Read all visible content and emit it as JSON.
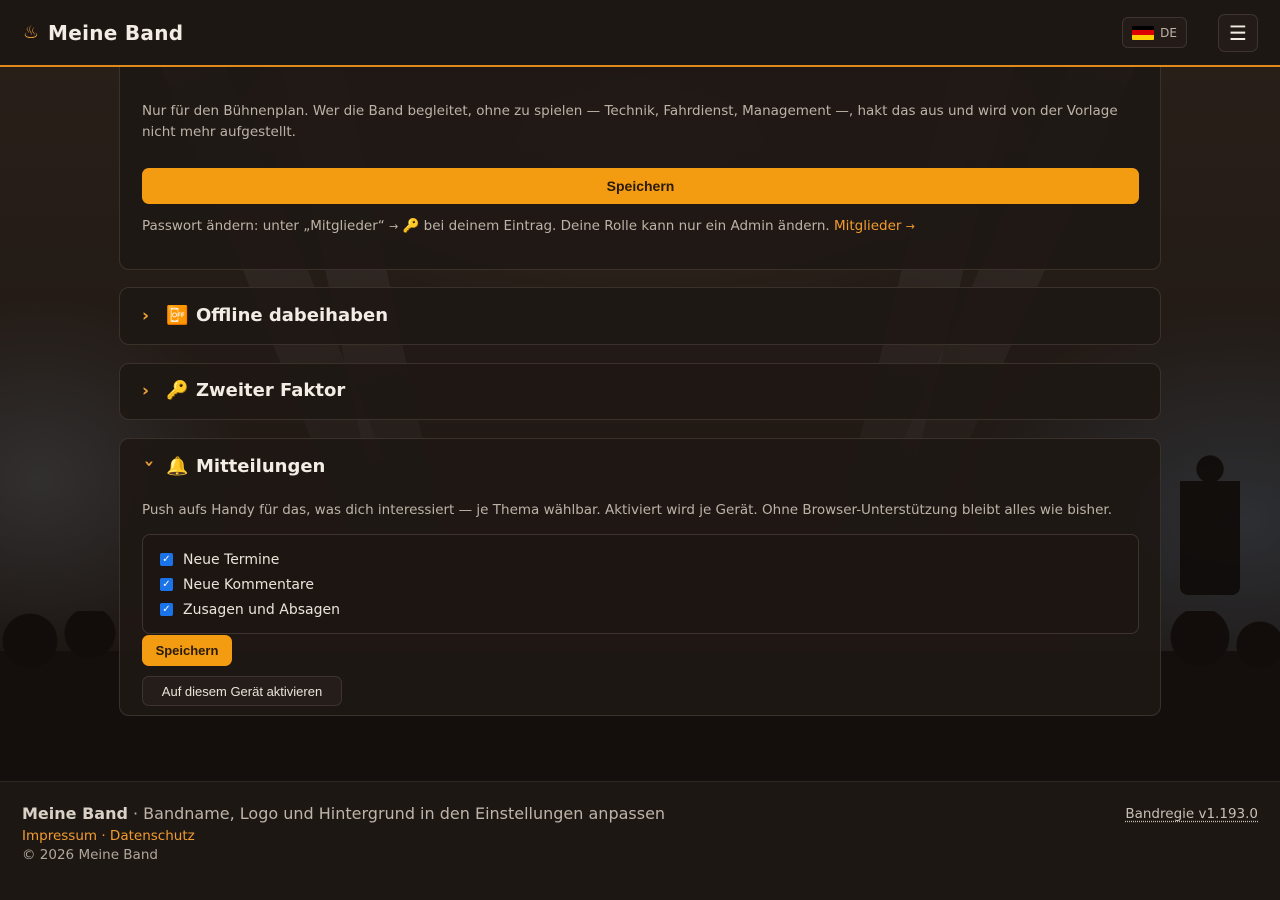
{
  "header": {
    "brand_icon": "♨",
    "brand_name": "Meine Band",
    "language_code": "DE",
    "menu_icon": "☰"
  },
  "top_card": {
    "hint": "Nur für den Bühnenplan. Wer die Band begleitet, ohne zu spielen — Technik, Fahrdienst, Management —, hakt das aus und wird von der Vorlage nicht mehr aufgestellt.",
    "save_label": "Speichern",
    "password_hint_before": "Passwort ändern: unter „Mitglieder“ ",
    "password_hint_after": " bei deinem Eintrag. Deine Rolle kann nur ein Admin ändern. ",
    "members_link": "Mitglieder"
  },
  "sections": {
    "offline": {
      "icon": "📴",
      "title": "Offline dabeihaben"
    },
    "two_factor": {
      "icon": "🔑",
      "title": "Zweiter Faktor"
    },
    "notifications": {
      "icon": "🔔",
      "title": "Mitteilungen",
      "description": "Push aufs Handy für das, was dich interessiert — je Thema wählbar. Aktiviert wird je Gerät. Ohne Browser-Unterstützung bleibt alles wie bisher.",
      "options": [
        {
          "label": "Neue Termine",
          "checked": true
        },
        {
          "label": "Neue Kommentare",
          "checked": true
        },
        {
          "label": "Zusagen und Absagen",
          "checked": true
        }
      ],
      "save_label": "Speichern",
      "activate_label": "Auf diesem Gerät aktivieren"
    }
  },
  "footer": {
    "brand": "Meine Band",
    "tagline": " · Bandname, Logo und Hintergrund in den Einstellungen anpassen",
    "imprint": "Impressum",
    "separator": " · ",
    "privacy": "Datenschutz",
    "copyright": "© 2026 Meine Band",
    "version": "Bandregie v1.193.0"
  },
  "colors": {
    "accent": "#f39c12",
    "link": "#f29b2f",
    "checkbox": "#1a73e8"
  }
}
